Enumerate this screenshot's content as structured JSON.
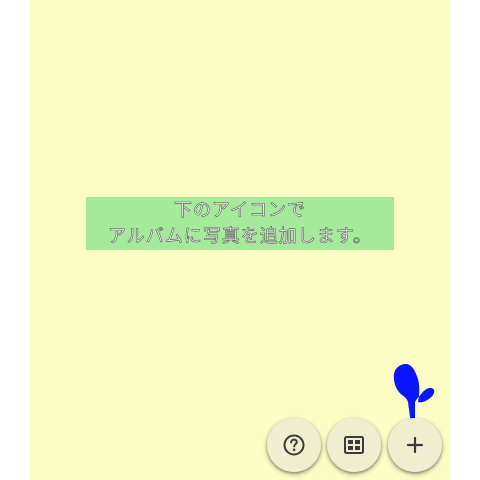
{
  "hint": {
    "line1": "下のアイコンで",
    "line2": "アルバムに写真を追加します。"
  },
  "fabs": [
    {
      "name": "help",
      "icon": "question-circle-icon"
    },
    {
      "name": "layout",
      "icon": "grid-icon"
    },
    {
      "name": "add",
      "icon": "plus-icon"
    }
  ],
  "pointer": {
    "icon": "pointing-hand-icon",
    "color": "#0a14ff"
  },
  "colors": {
    "paper": "#fbfdc4",
    "hint_bg": "#a5e99a",
    "fab_bg": "#efefcf",
    "icon": "#3a3a3a"
  }
}
